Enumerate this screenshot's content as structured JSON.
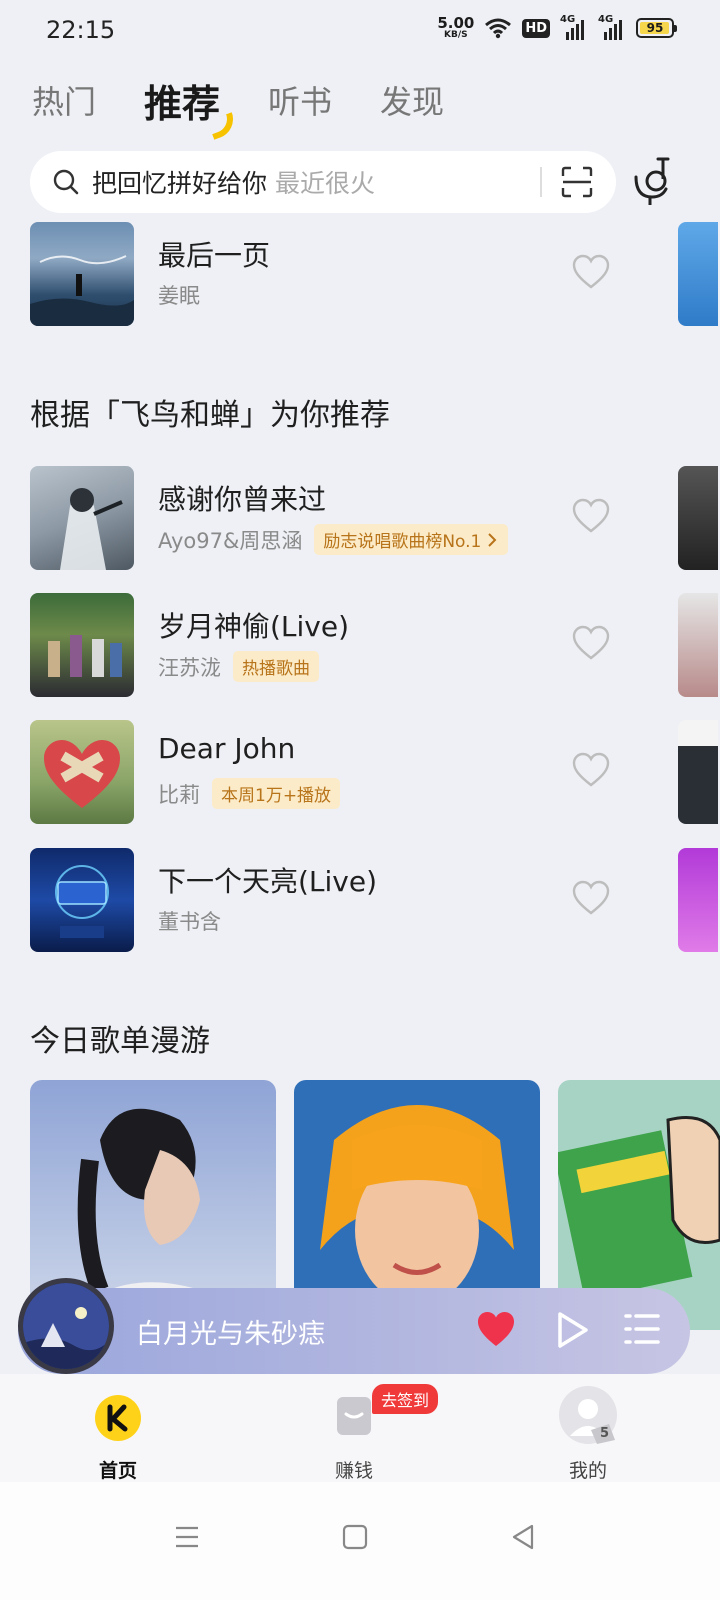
{
  "status_bar": {
    "time": "22:15",
    "net_speed_value": "5.00",
    "net_speed_unit": "KB/S",
    "hd_label": "HD",
    "sim1_label": "4G",
    "sim2_label": "4G",
    "battery_level": "95"
  },
  "top_tabs": [
    "热门",
    "推荐",
    "听书",
    "发现"
  ],
  "active_tab": "推荐",
  "search": {
    "query": "把回忆拼好给你",
    "hint": "最近很火"
  },
  "first_song": {
    "title": "最后一页",
    "artist": "姜眠"
  },
  "recommend_section_title": "根据「飞鸟和蝉」为你推荐",
  "songs": [
    {
      "title": "感谢你曾来过",
      "artist": "Ayo97&周思涵",
      "tag": "励志说唱歌曲榜No.1"
    },
    {
      "title": "岁月神偷(Live)",
      "artist": "汪苏泷",
      "tag": "热播歌曲"
    },
    {
      "title": "Dear John",
      "artist": "比莉",
      "tag": "本周1万+播放"
    },
    {
      "title": "下一个天亮(Live)",
      "artist": "董书含",
      "tag": ""
    }
  ],
  "playlist_section_title": "今日歌单漫游",
  "mini_player": {
    "title": "白月光与朱砂痣"
  },
  "bottom_nav": {
    "home_label": "首页",
    "earn_label": "赚钱",
    "earn_badge": "去签到",
    "me_label": "我的",
    "me_level": "5"
  },
  "colors": {
    "accent": "#f7c300",
    "tag_bg": "#fcebc8",
    "tag_text": "#b8741a",
    "badge_red": "#f03a3a",
    "heart_red": "#f0334c"
  }
}
